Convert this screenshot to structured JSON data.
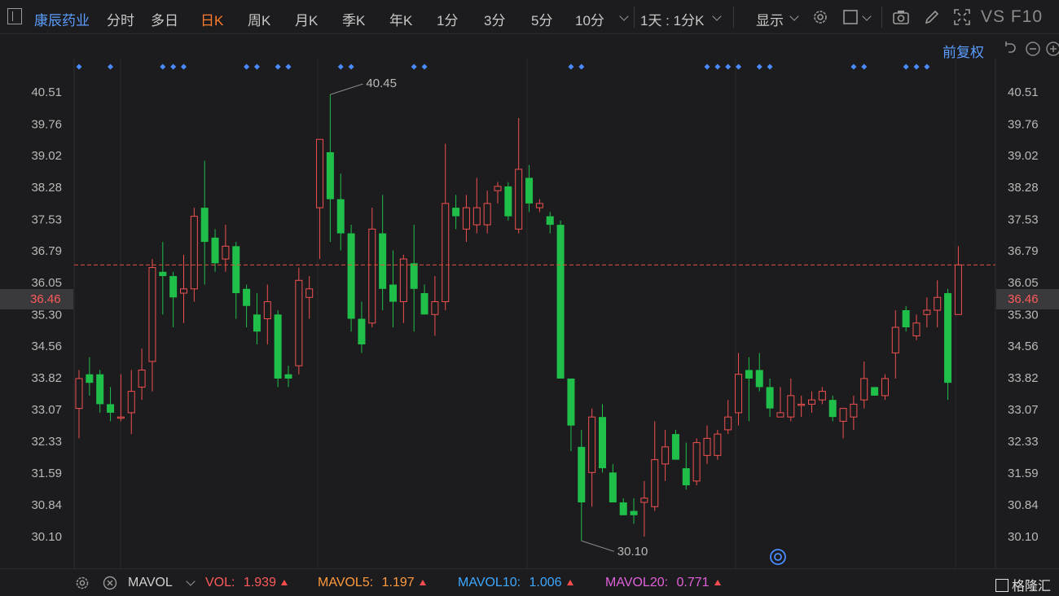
{
  "toolbar": {
    "stock_name": "康辰药业",
    "tabs": [
      {
        "label": "分时",
        "active": false
      },
      {
        "label": "多日",
        "active": false
      },
      {
        "label": "日K",
        "active": true
      },
      {
        "label": "周K",
        "active": false
      },
      {
        "label": "月K",
        "active": false
      },
      {
        "label": "季K",
        "active": false
      },
      {
        "label": "年K",
        "active": false
      },
      {
        "label": "1分",
        "active": false
      },
      {
        "label": "3分",
        "active": false
      },
      {
        "label": "5分",
        "active": false
      },
      {
        "label": "10分",
        "active": false
      }
    ],
    "interval_label": "1天 : 1分K",
    "display_label": "显示",
    "icons": [
      "gear-icon",
      "square-icon",
      "camera-icon",
      "pen-icon",
      "fullscreen-icon"
    ],
    "vs_f10": "VS F10"
  },
  "subbar": {
    "adjust_label": "前复权",
    "icons": [
      "undo-icon",
      "zoom-out-icon",
      "zoom-in-icon"
    ]
  },
  "chart_data": {
    "type": "candlestick",
    "y_ticks": [
      "40.51",
      "39.76",
      "39.02",
      "38.28",
      "37.53",
      "36.79",
      "36.05",
      "35.30",
      "34.56",
      "33.82",
      "33.07",
      "32.33",
      "31.59",
      "30.84",
      "30.10"
    ],
    "ylim": [
      29.5,
      41.2
    ],
    "current_price": "36.46",
    "max_label": "40.45",
    "min_label": "30.10",
    "colors": {
      "up": "#f0504f",
      "down": "#1fbf4a",
      "price_line": "#e0503c",
      "marker": "#4a8cff"
    },
    "candles": [
      {
        "o": 33.1,
        "h": 34.0,
        "l": 32.4,
        "c": 33.8
      },
      {
        "o": 33.9,
        "h": 34.3,
        "l": 33.4,
        "c": 33.7
      },
      {
        "o": 33.9,
        "h": 34.0,
        "l": 33.0,
        "c": 33.2
      },
      {
        "o": 33.2,
        "h": 33.6,
        "l": 32.8,
        "c": 33.0
      },
      {
        "o": 32.9,
        "h": 33.9,
        "l": 32.8,
        "c": 32.9
      },
      {
        "o": 33.0,
        "h": 34.0,
        "l": 32.5,
        "c": 33.5
      },
      {
        "o": 33.6,
        "h": 34.5,
        "l": 33.3,
        "c": 34.0
      },
      {
        "o": 34.2,
        "h": 36.6,
        "l": 33.5,
        "c": 36.4
      },
      {
        "o": 36.3,
        "h": 37.0,
        "l": 35.3,
        "c": 36.2
      },
      {
        "o": 36.2,
        "h": 36.3,
        "l": 35.0,
        "c": 35.7
      },
      {
        "o": 35.8,
        "h": 36.7,
        "l": 35.1,
        "c": 35.9
      },
      {
        "o": 35.9,
        "h": 37.8,
        "l": 35.6,
        "c": 37.6
      },
      {
        "o": 37.8,
        "h": 38.9,
        "l": 36.0,
        "c": 37.0
      },
      {
        "o": 37.1,
        "h": 37.3,
        "l": 36.3,
        "c": 36.5
      },
      {
        "o": 36.6,
        "h": 37.4,
        "l": 36.3,
        "c": 36.9
      },
      {
        "o": 36.9,
        "h": 37.0,
        "l": 35.2,
        "c": 35.8
      },
      {
        "o": 35.9,
        "h": 36.0,
        "l": 35.0,
        "c": 35.5
      },
      {
        "o": 35.3,
        "h": 35.8,
        "l": 34.6,
        "c": 34.9
      },
      {
        "o": 35.2,
        "h": 36.0,
        "l": 34.6,
        "c": 35.6
      },
      {
        "o": 35.3,
        "h": 35.4,
        "l": 33.6,
        "c": 33.8
      },
      {
        "o": 33.9,
        "h": 34.1,
        "l": 33.6,
        "c": 33.8
      },
      {
        "o": 34.1,
        "h": 36.4,
        "l": 33.9,
        "c": 36.1
      },
      {
        "o": 35.7,
        "h": 36.2,
        "l": 35.2,
        "c": 35.9
      },
      {
        "o": 37.8,
        "h": 39.4,
        "l": 36.6,
        "c": 39.4
      },
      {
        "o": 39.1,
        "h": 40.45,
        "l": 37.0,
        "c": 38.0
      },
      {
        "o": 38.0,
        "h": 38.6,
        "l": 36.8,
        "c": 37.2
      },
      {
        "o": 37.2,
        "h": 37.4,
        "l": 34.9,
        "c": 35.2
      },
      {
        "o": 35.2,
        "h": 35.6,
        "l": 34.4,
        "c": 34.6
      },
      {
        "o": 35.1,
        "h": 37.8,
        "l": 35.0,
        "c": 37.3
      },
      {
        "o": 37.2,
        "h": 38.1,
        "l": 35.4,
        "c": 35.9
      },
      {
        "o": 36.0,
        "h": 36.8,
        "l": 35.0,
        "c": 35.6
      },
      {
        "o": 35.6,
        "h": 36.7,
        "l": 35.1,
        "c": 36.6
      },
      {
        "o": 36.5,
        "h": 37.4,
        "l": 34.9,
        "c": 35.9
      },
      {
        "o": 35.8,
        "h": 36.0,
        "l": 35.3,
        "c": 35.3
      },
      {
        "o": 35.3,
        "h": 36.2,
        "l": 34.8,
        "c": 35.6
      },
      {
        "o": 35.6,
        "h": 39.3,
        "l": 35.4,
        "c": 37.9
      },
      {
        "o": 37.8,
        "h": 38.1,
        "l": 37.3,
        "c": 37.6
      },
      {
        "o": 37.3,
        "h": 38.1,
        "l": 37.0,
        "c": 37.8
      },
      {
        "o": 37.4,
        "h": 38.5,
        "l": 37.2,
        "c": 37.8
      },
      {
        "o": 37.4,
        "h": 38.2,
        "l": 37.2,
        "c": 37.9
      },
      {
        "o": 38.2,
        "h": 38.4,
        "l": 37.9,
        "c": 38.3
      },
      {
        "o": 38.3,
        "h": 38.4,
        "l": 37.5,
        "c": 37.6
      },
      {
        "o": 37.3,
        "h": 39.9,
        "l": 37.2,
        "c": 38.7
      },
      {
        "o": 38.5,
        "h": 38.8,
        "l": 37.7,
        "c": 37.9
      },
      {
        "o": 37.8,
        "h": 38.0,
        "l": 37.7,
        "c": 37.9
      },
      {
        "o": 37.6,
        "h": 37.7,
        "l": 37.2,
        "c": 37.4
      },
      {
        "o": 37.4,
        "h": 37.5,
        "l": 33.8,
        "c": 33.8
      },
      {
        "o": 33.8,
        "h": 33.8,
        "l": 32.1,
        "c": 32.7
      },
      {
        "o": 32.2,
        "h": 32.6,
        "l": 30.0,
        "c": 30.9
      },
      {
        "o": 31.6,
        "h": 33.1,
        "l": 30.8,
        "c": 32.9
      },
      {
        "o": 32.9,
        "h": 33.2,
        "l": 31.6,
        "c": 31.7
      },
      {
        "o": 31.6,
        "h": 31.8,
        "l": 30.9,
        "c": 30.9
      },
      {
        "o": 30.9,
        "h": 31.0,
        "l": 30.6,
        "c": 30.6
      },
      {
        "o": 30.7,
        "h": 31.0,
        "l": 30.4,
        "c": 30.6
      },
      {
        "o": 30.9,
        "h": 31.4,
        "l": 30.1,
        "c": 31.0
      },
      {
        "o": 30.8,
        "h": 32.8,
        "l": 30.7,
        "c": 31.9
      },
      {
        "o": 31.8,
        "h": 32.6,
        "l": 31.4,
        "c": 32.2
      },
      {
        "o": 32.5,
        "h": 32.6,
        "l": 31.9,
        "c": 31.9
      },
      {
        "o": 31.7,
        "h": 32.3,
        "l": 31.2,
        "c": 31.3
      },
      {
        "o": 31.4,
        "h": 32.4,
        "l": 31.3,
        "c": 32.3
      },
      {
        "o": 32.0,
        "h": 32.7,
        "l": 31.8,
        "c": 32.4
      },
      {
        "o": 32.0,
        "h": 32.6,
        "l": 31.9,
        "c": 32.5
      },
      {
        "o": 32.6,
        "h": 33.3,
        "l": 32.5,
        "c": 32.9
      },
      {
        "o": 33.0,
        "h": 34.4,
        "l": 32.7,
        "c": 33.9
      },
      {
        "o": 34.0,
        "h": 34.3,
        "l": 32.8,
        "c": 33.8
      },
      {
        "o": 34.0,
        "h": 34.4,
        "l": 33.5,
        "c": 33.6
      },
      {
        "o": 33.6,
        "h": 33.8,
        "l": 32.9,
        "c": 33.1
      },
      {
        "o": 32.9,
        "h": 33.6,
        "l": 32.9,
        "c": 33.0
      },
      {
        "o": 32.9,
        "h": 33.8,
        "l": 32.8,
        "c": 33.4
      },
      {
        "o": 33.2,
        "h": 33.4,
        "l": 32.9,
        "c": 33.2
      },
      {
        "o": 33.2,
        "h": 33.5,
        "l": 33.0,
        "c": 33.3
      },
      {
        "o": 33.3,
        "h": 33.6,
        "l": 33.2,
        "c": 33.5
      },
      {
        "o": 33.3,
        "h": 33.4,
        "l": 32.8,
        "c": 32.9
      },
      {
        "o": 32.8,
        "h": 33.1,
        "l": 32.4,
        "c": 33.1
      },
      {
        "o": 32.9,
        "h": 33.4,
        "l": 32.6,
        "c": 33.2
      },
      {
        "o": 33.3,
        "h": 34.2,
        "l": 33.1,
        "c": 33.8
      },
      {
        "o": 33.6,
        "h": 33.6,
        "l": 33.4,
        "c": 33.4
      },
      {
        "o": 33.4,
        "h": 33.9,
        "l": 33.3,
        "c": 33.8
      },
      {
        "o": 34.4,
        "h": 35.4,
        "l": 33.8,
        "c": 35.0
      },
      {
        "o": 35.4,
        "h": 35.5,
        "l": 34.9,
        "c": 35.0
      },
      {
        "o": 34.8,
        "h": 35.3,
        "l": 34.7,
        "c": 35.1
      },
      {
        "o": 35.3,
        "h": 35.7,
        "l": 35.0,
        "c": 35.4
      },
      {
        "o": 35.4,
        "h": 36.1,
        "l": 35.0,
        "c": 35.7
      },
      {
        "o": 35.8,
        "h": 35.9,
        "l": 33.3,
        "c": 33.7
      },
      {
        "o": 35.3,
        "h": 36.9,
        "l": 35.3,
        "c": 36.46
      }
    ],
    "markers": [
      0,
      3,
      8,
      9,
      10,
      16,
      17,
      19,
      20,
      25,
      26,
      32,
      33,
      47,
      48,
      60,
      61,
      62,
      63,
      65,
      66,
      74,
      75,
      79,
      80,
      81
    ]
  },
  "bottom": {
    "mavol_label": "MAVOL",
    "items": [
      {
        "name": "VOL:",
        "value": "1.939",
        "color": "#ff5a5a"
      },
      {
        "name": "MAVOL5:",
        "value": "1.197",
        "color": "#ff9a3c"
      },
      {
        "name": "MAVOL10:",
        "value": "1.006",
        "color": "#3ea8ff"
      },
      {
        "name": "MAVOL20:",
        "value": "0.771",
        "color": "#e060d8"
      }
    ],
    "brand": "格隆汇"
  }
}
